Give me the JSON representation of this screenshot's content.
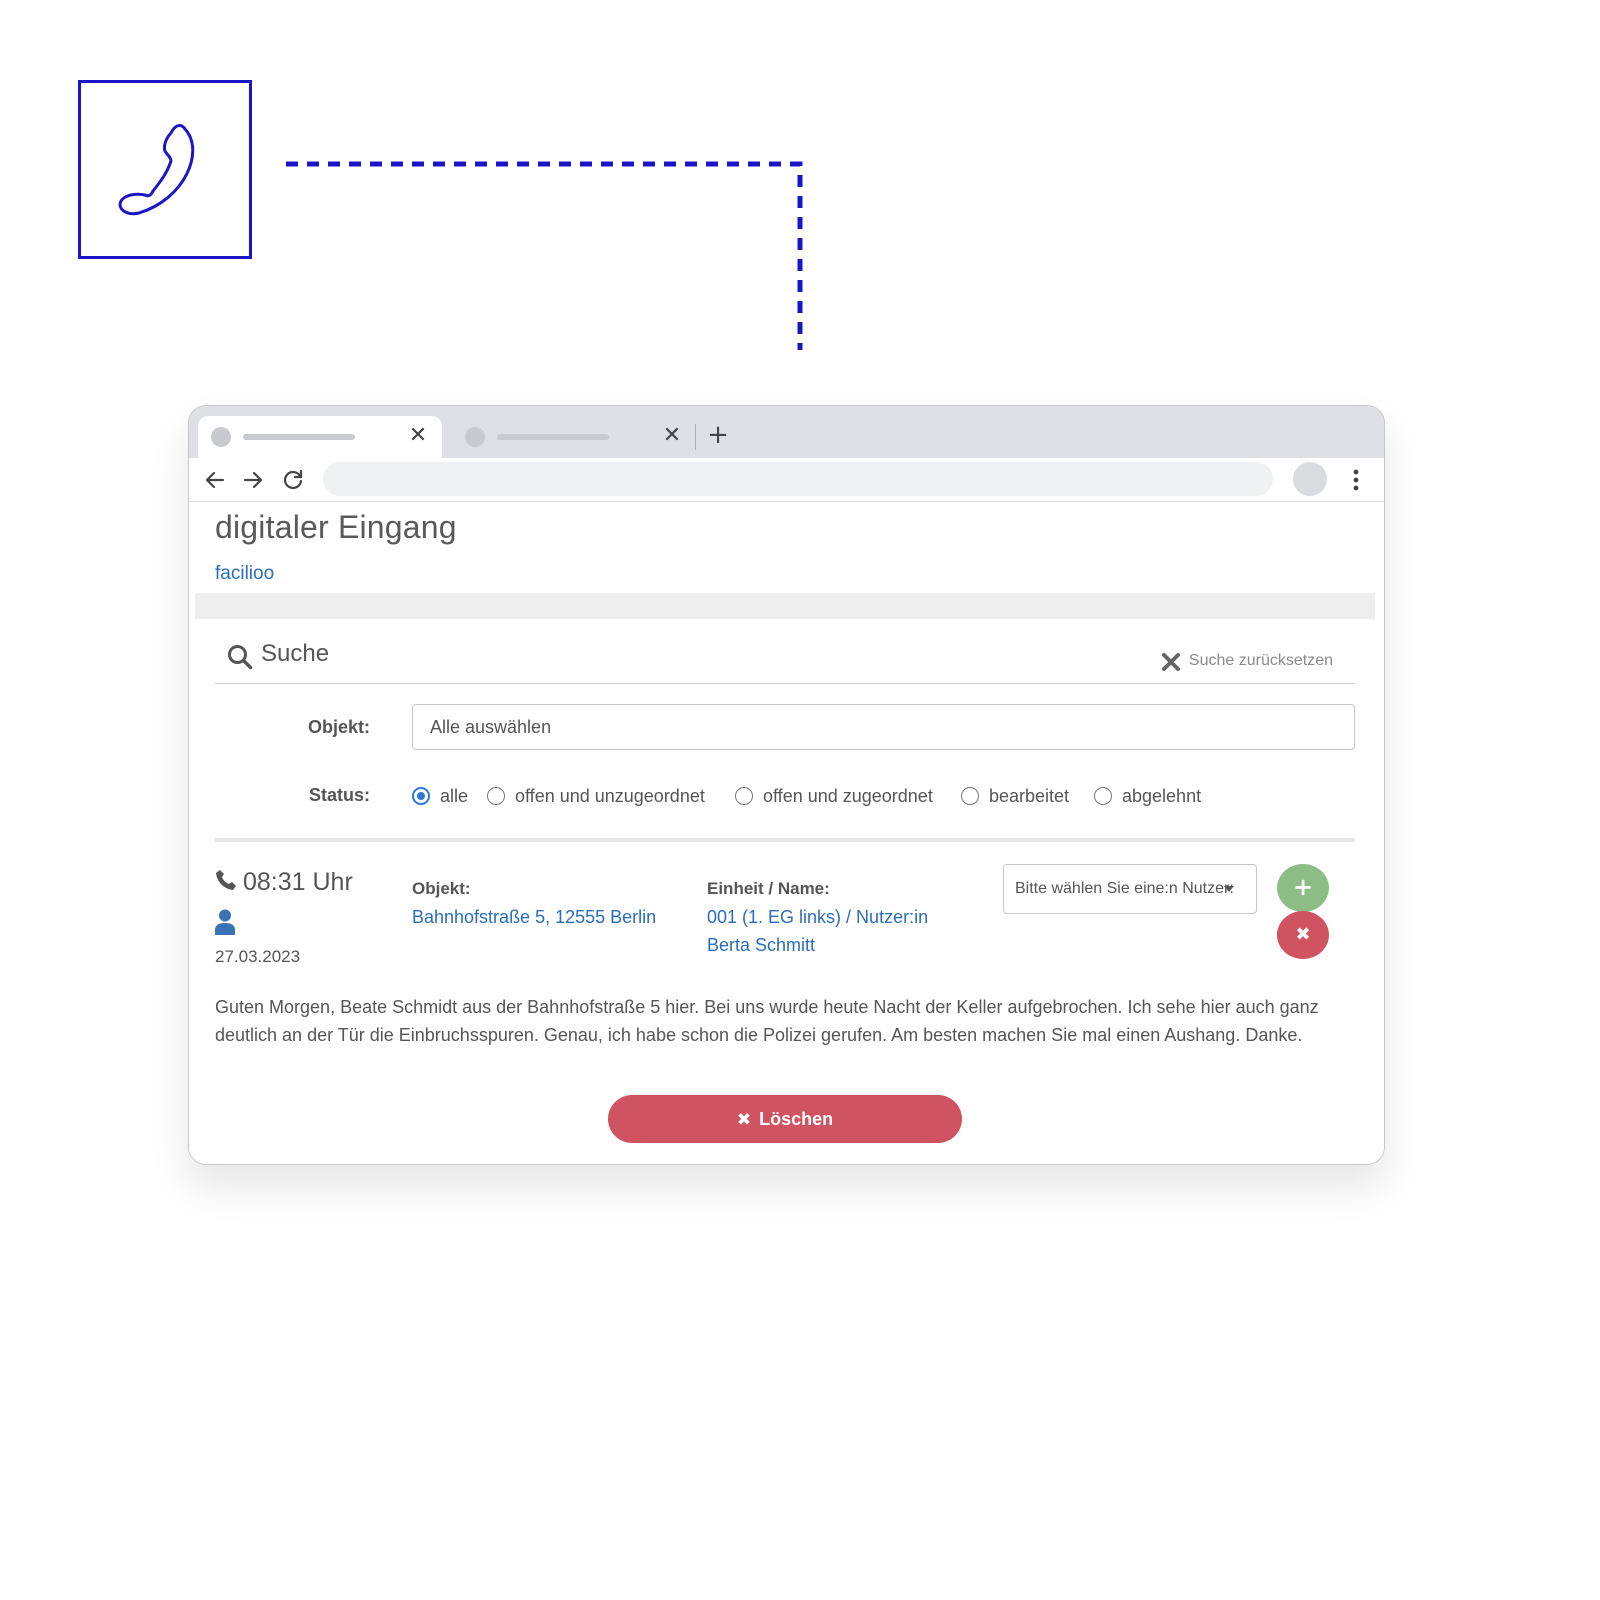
{
  "colors": {
    "accent_blue": "#1a16c8",
    "link": "#2a6ebb",
    "radio_checked": "#2f78d4",
    "add_green": "#8cbd85",
    "danger_red": "#cf5360"
  },
  "decor": {
    "phone_icon": "phone-handset-icon"
  },
  "browser": {
    "tabs": [
      {
        "close_glyph": "✕"
      },
      {
        "close_glyph": "✕"
      }
    ],
    "new_tab_glyph": "+"
  },
  "page": {
    "title": "digitaler Eingang",
    "brand": "facilioo"
  },
  "search": {
    "title": "Suche",
    "reset_label": "Suche zurücksetzen",
    "objekt_label": "Objekt:",
    "objekt_value": "Alle auswählen",
    "status_label": "Status:",
    "status_options": [
      {
        "label": "alle",
        "checked": true
      },
      {
        "label": "offen und unzugeordnet",
        "checked": false
      },
      {
        "label": "offen und zugeordnet",
        "checked": false
      },
      {
        "label": "bearbeitet",
        "checked": false
      },
      {
        "label": "abgelehnt",
        "checked": false
      }
    ]
  },
  "entry": {
    "time": "08:31 Uhr",
    "date": "27.03.2023",
    "objekt_label": "Objekt:",
    "objekt_value": "Bahnhofstraße 5, 12555 Berlin",
    "einheit_label": "Einheit / Name:",
    "einheit_line1": "001 (1. EG links) / Nutzer:in",
    "einheit_line2": "Berta Schmitt",
    "user_select_placeholder": "Bitte wählen Sie eine:n Nutzer:",
    "add_glyph": "+",
    "reject_glyph": "✖",
    "message": "Guten Morgen, Beate Schmidt aus der Bahnhofstraße 5 hier. Bei uns wurde heute Nacht der Keller aufgebrochen. Ich sehe hier auch ganz deutlich an der Tür die Einbruchsspuren. Genau, ich habe schon die Polizei gerufen. Am besten machen Sie mal einen Aushang. Danke.",
    "delete_glyph": "✖",
    "delete_label": "Löschen"
  }
}
